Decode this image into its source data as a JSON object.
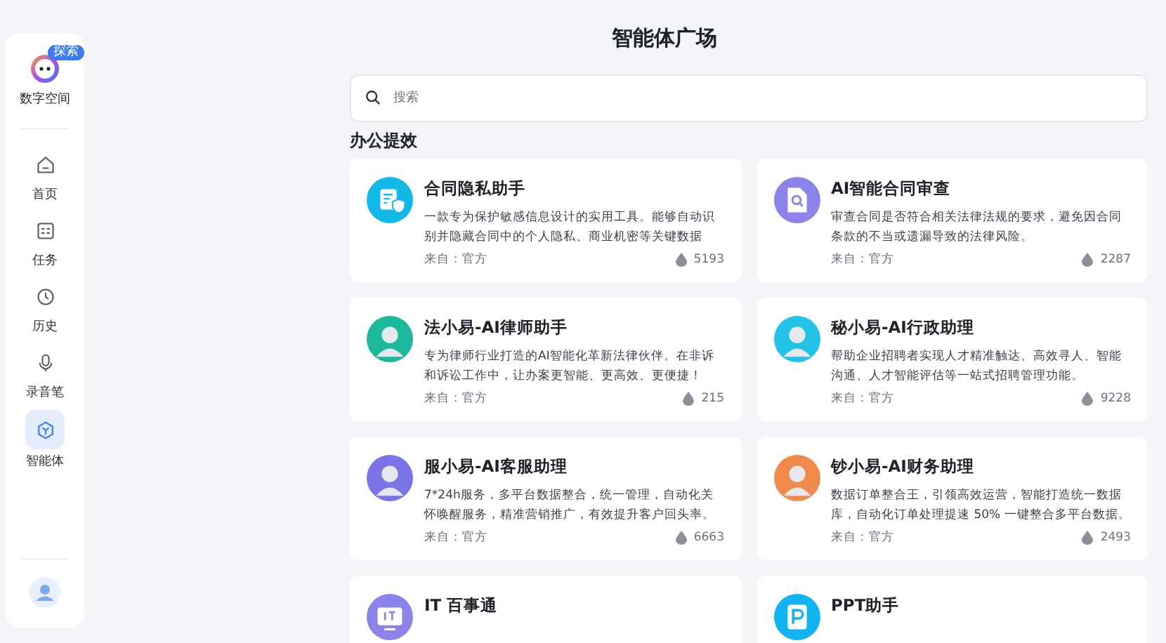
{
  "sidebar": {
    "logo": {
      "badge": "探索",
      "name": "数字空间"
    },
    "items": [
      {
        "label": "首页",
        "kind": "home",
        "selected": false
      },
      {
        "label": "任务",
        "kind": "task",
        "selected": false
      },
      {
        "label": "历史",
        "kind": "history",
        "selected": false
      },
      {
        "label": "录音笔",
        "kind": "mic",
        "selected": false
      },
      {
        "label": "智能体",
        "kind": "agent",
        "selected": true
      }
    ]
  },
  "page_title": "智能体广场",
  "search": {
    "placeholder": "搜索"
  },
  "section": {
    "title": "办公提效",
    "cards": [
      {
        "title": "合同隐私助手",
        "kind": "doc-shield",
        "color": "#12b8e8",
        "description": "一款专为保护敏感信息设计的实用工具。能够自动识别并隐藏合同中的个人隐私、商业机密等关键数据",
        "source": "来自：官方",
        "count": "5193"
      },
      {
        "title": "AI智能合同审查",
        "kind": "doc-search",
        "color": "#8b83e8",
        "description": "审查合同是否符合相关法律法规的要求，避免因合同条款的不当或遗漏导致的法律风险。",
        "source": "来自：官方",
        "count": "2287"
      },
      {
        "title": "法小易-AI律师助手",
        "kind": "avatar",
        "color": "#1cb89c",
        "description": "专为律师行业打造的AI智能化革新法律伙伴。在非诉和诉讼工作中，让办案更智能、更高效、更便捷！",
        "source": "来自：官方",
        "count": "215"
      },
      {
        "title": "秘小易-AI行政助理",
        "kind": "avatar",
        "color": "#22c3e6",
        "description": "帮助企业招聘者实现人才精准触达、高效寻人、智能沟通、人才智能评估等一站式招聘管理功能。",
        "source": "来自：官方",
        "count": "9228"
      },
      {
        "title": "服小易-AI客服助理",
        "kind": "avatar",
        "color": "#7b74e6",
        "description": "7*24h服务，多平台数据整合，统一管理，自动化关怀唤醒服务，精准营销推广，有效提升客户回头率。",
        "source": "来自：官方",
        "count": "6663"
      },
      {
        "title": "钞小易-AI财务助理",
        "kind": "avatar",
        "color": "#f08a4b",
        "description": "数据订单整合王，引领高效运营，智能打造统一数据库，自动化订单处理提速 50% 一键整合多平台数据。",
        "source": "来自：官方",
        "count": "2493"
      },
      {
        "title": "IT 百事通",
        "kind": "it",
        "color": "#8b83e8"
      },
      {
        "title": "PPT助手",
        "kind": "ppt",
        "color": "#12b4f0"
      }
    ]
  }
}
